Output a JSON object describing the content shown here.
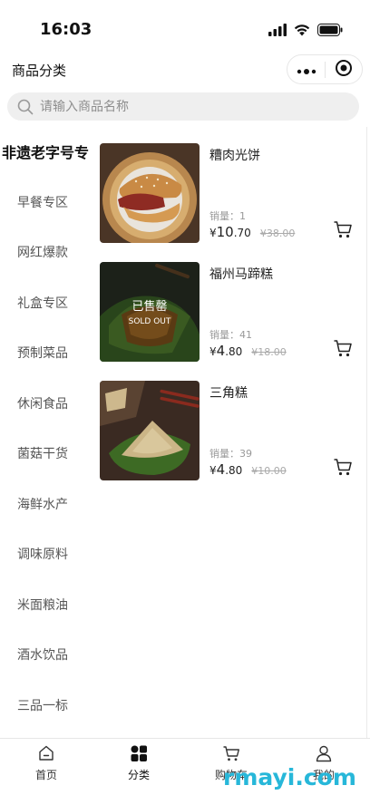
{
  "status_bar": {
    "time": "16:03"
  },
  "nav": {
    "title": "商品分类"
  },
  "search": {
    "placeholder": "请输入商品名称"
  },
  "categories": [
    {
      "label": "非遗老字号专区",
      "active": true
    },
    {
      "label": "早餐专区"
    },
    {
      "label": "网红爆款"
    },
    {
      "label": "礼盒专区"
    },
    {
      "label": "预制菜品"
    },
    {
      "label": "休闲食品"
    },
    {
      "label": "菌菇干货"
    },
    {
      "label": "海鲜水产"
    },
    {
      "label": "调味原料"
    },
    {
      "label": "米面粮油"
    },
    {
      "label": "酒水饮品"
    },
    {
      "label": "三品一标"
    }
  ],
  "products": [
    {
      "name": "糟肉光饼",
      "sales": "销量：1",
      "currency": "¥",
      "price_int": "10",
      "price_dec": ".70",
      "orig_price": "¥38.00",
      "sold_out": false
    },
    {
      "name": "福州马蹄糕",
      "sales": "销量：41",
      "currency": "¥",
      "price_int": "4",
      "price_dec": ".80",
      "orig_price": "¥18.00",
      "sold_out": true,
      "sold_out_label": "已售罄",
      "sold_out_en": "SOLD OUT"
    },
    {
      "name": "三角糕",
      "sales": "销量：39",
      "currency": "¥",
      "price_int": "4",
      "price_dec": ".80",
      "orig_price": "¥10.00",
      "sold_out": false
    }
  ],
  "tabs": [
    {
      "label": "首页",
      "icon": "home-icon"
    },
    {
      "label": "分类",
      "icon": "category-icon",
      "active": true
    },
    {
      "label": "购物车",
      "icon": "cart-icon"
    },
    {
      "label": "我的",
      "icon": "user-icon"
    }
  ],
  "watermark": "rmayi.com",
  "colors": {
    "accent": "#111111",
    "muted": "#999999",
    "watermark": "#27b7d9"
  }
}
